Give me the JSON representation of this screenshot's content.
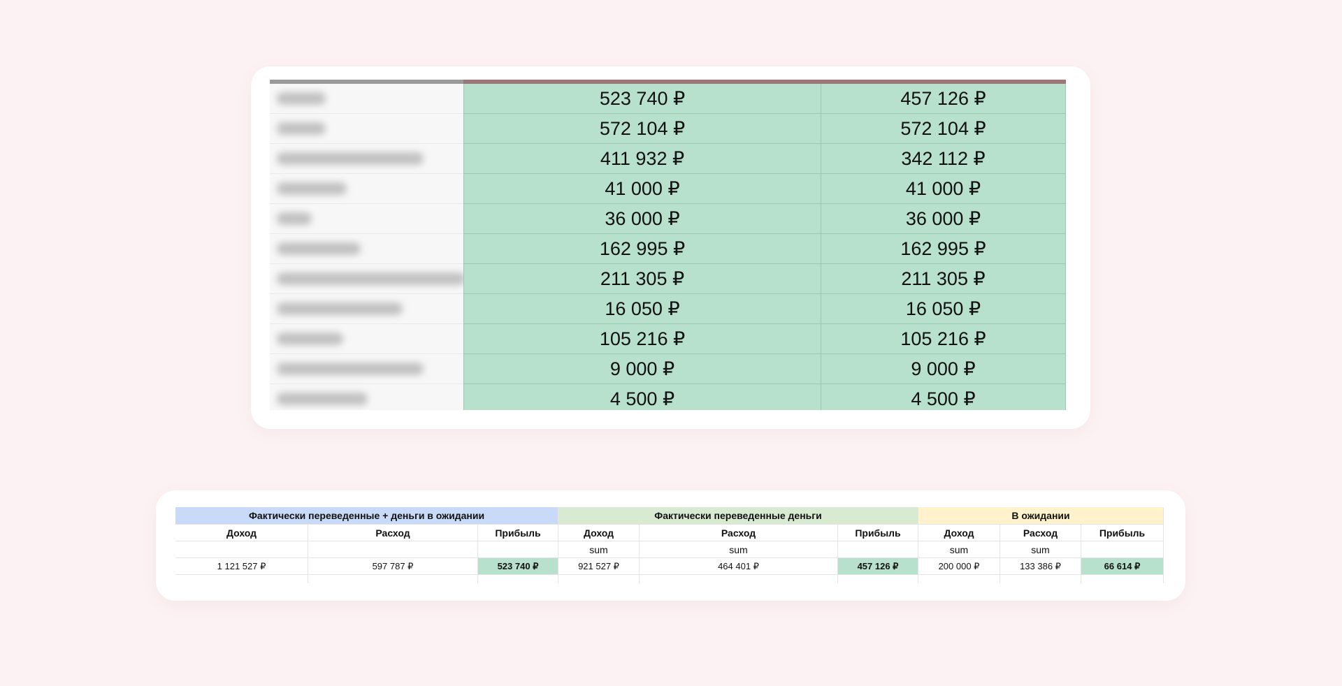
{
  "top_table": {
    "rows": [
      {
        "a": "523 740 ₽",
        "b": "457 126 ₽"
      },
      {
        "a": "572 104 ₽",
        "b": "572 104 ₽"
      },
      {
        "a": "411 932 ₽",
        "b": "342 112 ₽"
      },
      {
        "a": "41 000 ₽",
        "b": "41 000 ₽"
      },
      {
        "a": "36 000 ₽",
        "b": "36 000 ₽"
      },
      {
        "a": "162 995 ₽",
        "b": "162 995 ₽"
      },
      {
        "a": "211 305 ₽",
        "b": "211 305 ₽"
      },
      {
        "a": "16 050 ₽",
        "b": "16 050 ₽"
      },
      {
        "a": "105 216 ₽",
        "b": "105 216 ₽"
      },
      {
        "a": "9 000 ₽",
        "b": "9 000 ₽"
      },
      {
        "a": "4 500 ₽",
        "b": "4 500 ₽"
      }
    ],
    "colors": {
      "value_fill": "#b7e1cd",
      "header_name": "#9a9a9a",
      "header_value": "#9c7777"
    }
  },
  "bottom_table": {
    "groups": {
      "combined": "Фактически переведенные + деньги в ожидании",
      "actual": "Фактически переведенные деньги",
      "pending": "В ожидании"
    },
    "headers": {
      "income": "Доход",
      "expense": "Расход",
      "profit": "Прибыль",
      "sum": "sum"
    },
    "values": {
      "combined_income": "1 121 527 ₽",
      "combined_expense": "597 787 ₽",
      "combined_profit": "523 740 ₽",
      "actual_income": "921 527 ₽",
      "actual_expense": "464 401 ₽",
      "actual_profit": "457 126 ₽",
      "pending_income": "200 000 ₽",
      "pending_expense": "133 386 ₽",
      "pending_profit": "66 614 ₽"
    },
    "colors": {
      "combined": "#c9daf8",
      "actual": "#d9ead3",
      "pending": "#fff2cc",
      "profit": "#b7e1cd"
    }
  }
}
